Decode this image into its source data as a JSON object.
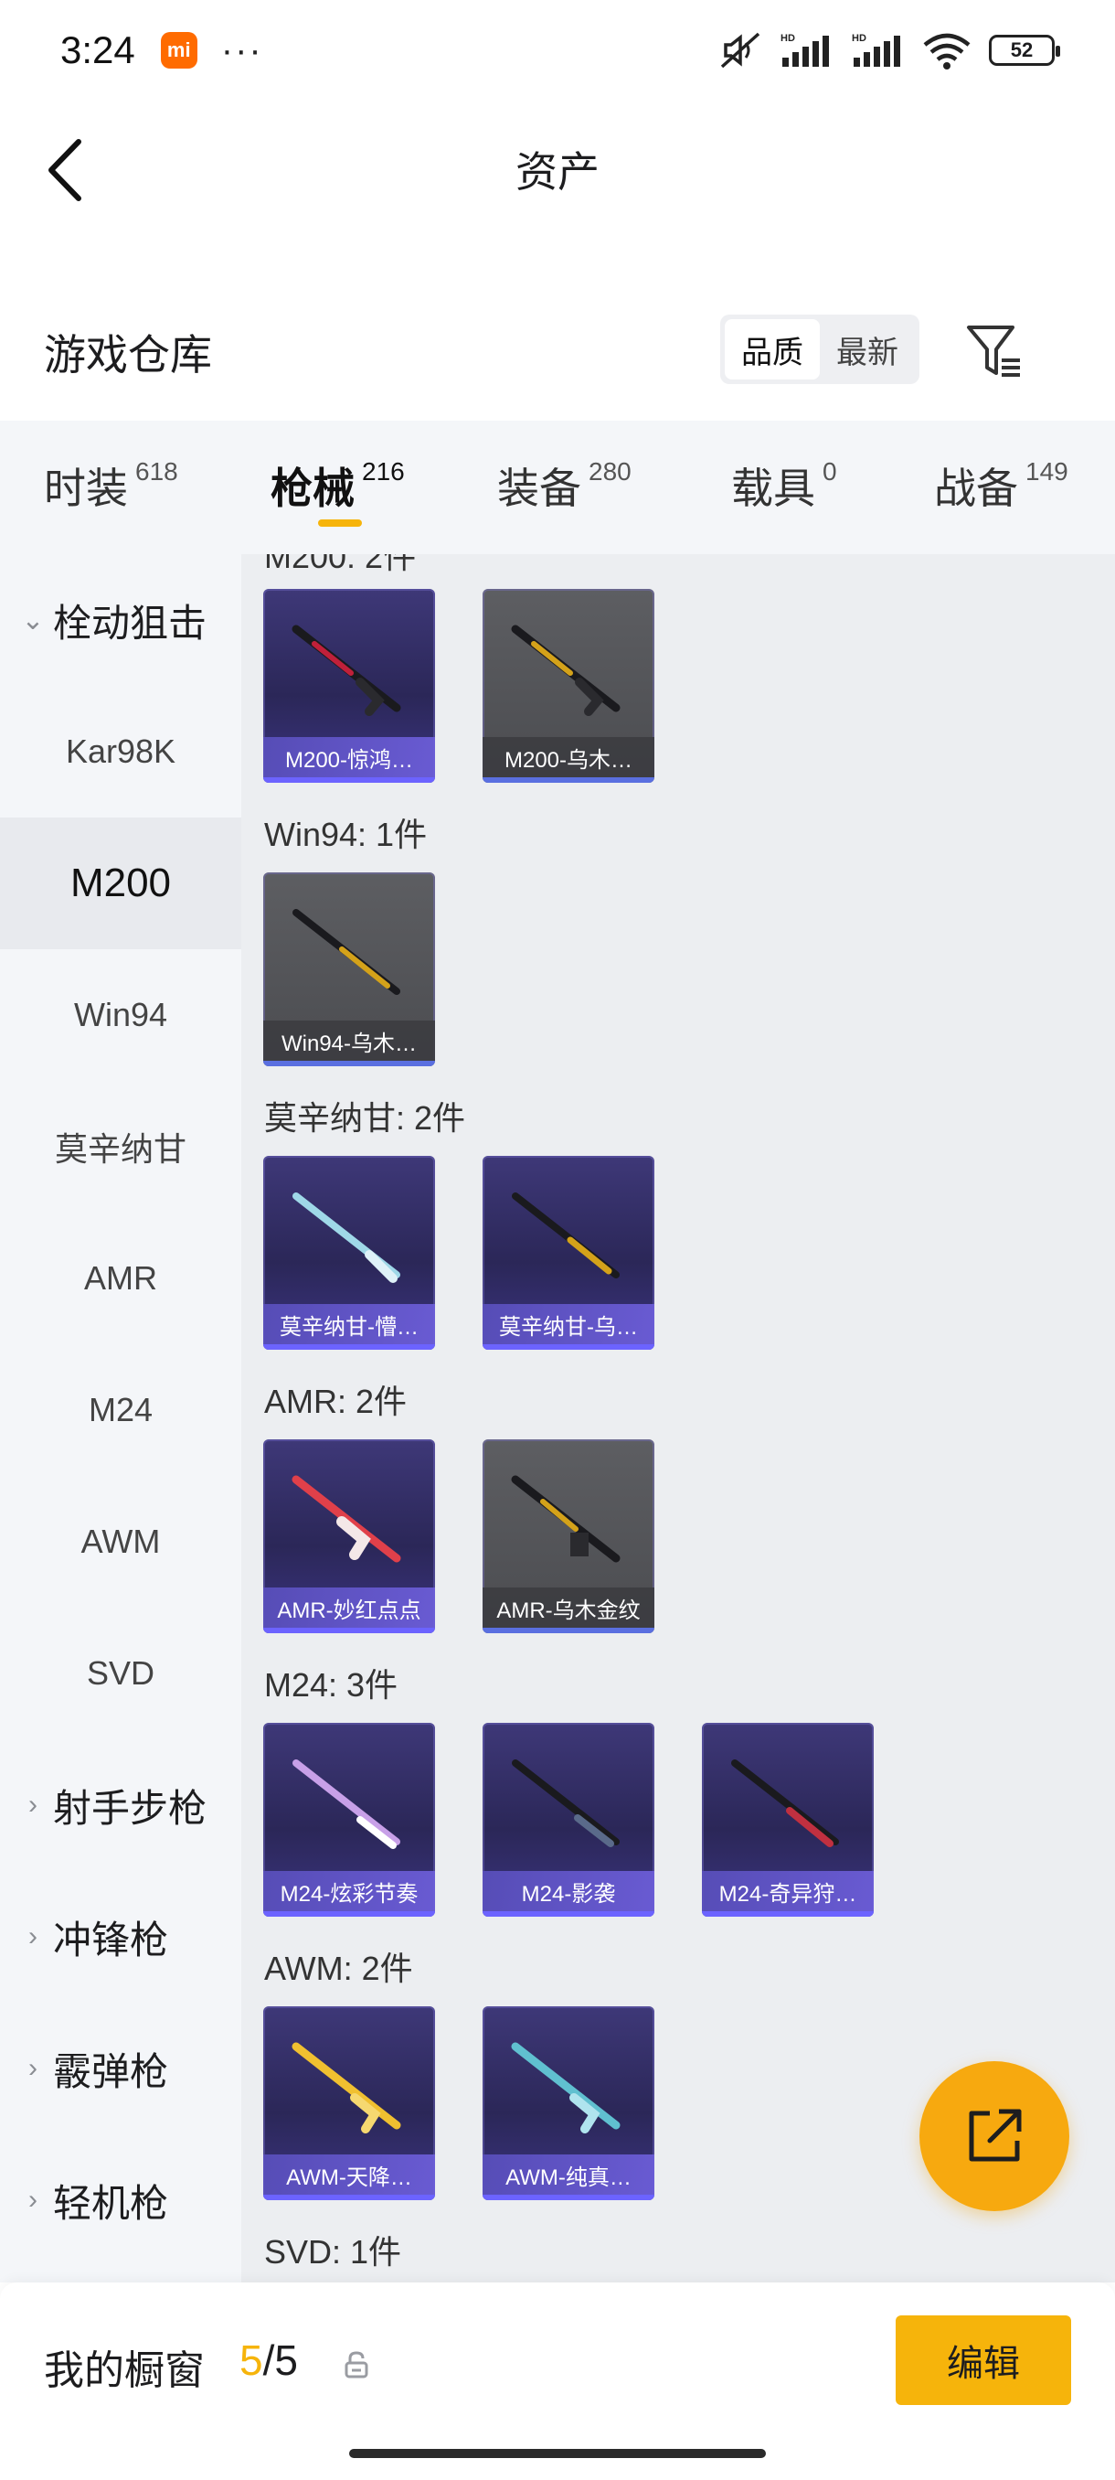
{
  "status_bar": {
    "time": "3:24",
    "mi_badge": "mi",
    "more": "···",
    "hd1": "HD",
    "hd2": "HD",
    "battery": "52"
  },
  "nav": {
    "title": "资产"
  },
  "warehouse": {
    "title": "游戏仓库",
    "sort_options": [
      "品质",
      "最新"
    ],
    "sort_selected": "品质"
  },
  "tabs": [
    {
      "label": "时装",
      "count": "618"
    },
    {
      "label": "枪械",
      "count": "216",
      "active": true
    },
    {
      "label": "装备",
      "count": "280"
    },
    {
      "label": "载具",
      "count": "0"
    },
    {
      "label": "战备",
      "count": "149"
    }
  ],
  "sidebar": {
    "items": [
      {
        "label": "栓动狙击",
        "type": "parent",
        "expanded": true
      },
      {
        "label": "Kar98K"
      },
      {
        "label": "M200",
        "selected": true
      },
      {
        "label": "Win94"
      },
      {
        "label": "莫辛纳甘"
      },
      {
        "label": "AMR"
      },
      {
        "label": "M24"
      },
      {
        "label": "AWM"
      },
      {
        "label": "SVD"
      },
      {
        "label": "射手步枪",
        "type": "parent"
      },
      {
        "label": "冲锋枪",
        "type": "parent"
      },
      {
        "label": "霰弹枪",
        "type": "parent"
      },
      {
        "label": "轻机枪",
        "type": "parent"
      }
    ]
  },
  "groups": [
    {
      "title": "M200: 2件",
      "items": [
        {
          "name": "M200-惊鸿…",
          "style": "purple",
          "accent": "#c0203a"
        },
        {
          "name": "M200-乌木…",
          "style": "gray",
          "accent": "#d4a21a"
        }
      ]
    },
    {
      "title": "Win94: 1件",
      "items": [
        {
          "name": "Win94-乌木…",
          "style": "gray",
          "accent": "#d4a21a"
        }
      ]
    },
    {
      "title": "莫辛纳甘: 2件",
      "items": [
        {
          "name": "莫辛纳甘-懵…",
          "style": "purple",
          "accent": "#9fd8e8"
        },
        {
          "name": "莫辛纳甘-乌…",
          "style": "purple",
          "accent": "#d4a21a"
        }
      ]
    },
    {
      "title": "AMR: 2件",
      "items": [
        {
          "name": "AMR-妙红点点",
          "style": "purple",
          "accent": "#e0404a"
        },
        {
          "name": "AMR-乌木金纹",
          "style": "gray",
          "accent": "#d4a21a"
        }
      ]
    },
    {
      "title": "M24: 3件",
      "items": [
        {
          "name": "M24-炫彩节奏",
          "style": "purple",
          "accent": "#c8a0e8"
        },
        {
          "name": "M24-影袭",
          "style": "purple",
          "accent": "#5a6a8a"
        },
        {
          "name": "M24-奇异狩…",
          "style": "purple",
          "accent": "#c03040"
        }
      ]
    },
    {
      "title": "AWM: 2件",
      "items": [
        {
          "name": "AWM-天降…",
          "style": "purple",
          "accent": "#f0c030"
        },
        {
          "name": "AWM-纯真…",
          "style": "purple",
          "accent": "#60c0d0"
        }
      ]
    },
    {
      "title": "SVD: 1件",
      "items": []
    }
  ],
  "bottom": {
    "title": "我的橱窗",
    "count_current": "5",
    "count_sep": "/",
    "count_max": "5",
    "edit_label": "编辑"
  },
  "colors": {
    "accent": "#f6b40b",
    "fab": "#f7a90f"
  }
}
